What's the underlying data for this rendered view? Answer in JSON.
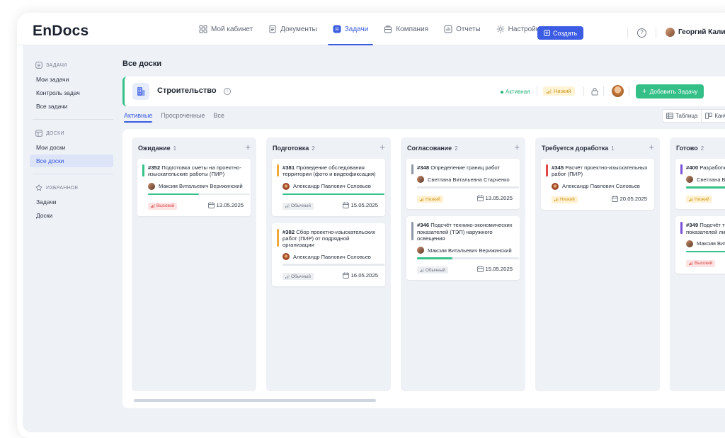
{
  "app": {
    "logo": "EnDocs"
  },
  "nav": [
    {
      "label": "Мой кабинет",
      "icon": "grid-icon",
      "active": false
    },
    {
      "label": "Документы",
      "icon": "document-icon",
      "active": false
    },
    {
      "label": "Задачи",
      "icon": "tasks-icon",
      "active": true
    },
    {
      "label": "Компания",
      "icon": "company-icon",
      "active": false
    },
    {
      "label": "Отчеты",
      "icon": "reports-icon",
      "active": false
    },
    {
      "label": "Настройки",
      "icon": "gear-icon",
      "active": false
    }
  ],
  "header": {
    "create_label": "Создать",
    "help_symbol": "?",
    "user_name": "Георгий Калинин"
  },
  "sidebar": {
    "sections": [
      {
        "title": "ЗАДАЧИ",
        "items": [
          "Мои задачи",
          "Контроль задач",
          "Все задачи"
        ]
      },
      {
        "title": "ДОСКИ",
        "items": [
          "Мои доски",
          "Все доски"
        ]
      },
      {
        "title": "ИЗБРАННОЕ",
        "items": [
          "Задачи",
          "Доски"
        ]
      }
    ],
    "active_item": "Все доски"
  },
  "page": {
    "title": "Все доски"
  },
  "board_header": {
    "title": "Строительство",
    "status": "Активная",
    "priority": "Низкий",
    "add_task_label": "Добавить Задачу"
  },
  "tabs": [
    "Активные",
    "Просроченные",
    "Все"
  ],
  "view_switch": {
    "table_label": "Таблица",
    "kanban_label": "Канбан"
  },
  "colors": {
    "accent": "#3b5ce0",
    "green": "#35c189",
    "high": "#d64545",
    "low": "#c99414"
  },
  "columns": [
    {
      "title": "Ожидание",
      "count": "1",
      "cards": [
        {
          "id": "#352",
          "title": "Подготовка сметы на проектно-изыскательские работы (ПИР)",
          "assignee": "Максим Витальевич Верижинский",
          "progress": 0.5,
          "priority": "Высокий",
          "priority_level": "high",
          "due": "13.05.2025",
          "bar_color": "#35c189"
        }
      ]
    },
    {
      "title": "Подготовка",
      "count": "2",
      "cards": [
        {
          "id": "#381",
          "title": "Проведение обследования территории (фото и видеофиксация)",
          "assignee": "Александр Павлович Соловьев",
          "progress": 1.0,
          "priority": "Обычный",
          "priority_level": "normal",
          "due": "15.05.2025",
          "bar_color": "#f2a93b"
        },
        {
          "id": "#382",
          "title": "Сбор проектно-изыскательских работ (ПИР) от подрядной организации",
          "assignee": "Александр Павлович Соловьев",
          "progress": 0,
          "priority": "Обычный",
          "priority_level": "normal",
          "due": "16.05.2025",
          "bar_color": "#f2a93b"
        }
      ]
    },
    {
      "title": "Согласование",
      "count": "2",
      "cards": [
        {
          "id": "#348",
          "title": "Определение границ работ",
          "assignee": "Светлана Витальевна Старченко",
          "progress": 0,
          "priority": "Низкий",
          "priority_level": "low",
          "due": "13.05.2025",
          "bar_color": "#8e97a8"
        },
        {
          "id": "#346",
          "title": "Подсчёт технико-экономических показателей (ТЭП) наружного освещения",
          "assignee": "Максим Витальевич Верижинский",
          "progress": 0.35,
          "priority": "Обычный",
          "priority_level": "normal",
          "due": "15.05.2025",
          "bar_color": "#8e97a8"
        }
      ]
    },
    {
      "title": "Требуется доработка",
      "count": "1",
      "cards": [
        {
          "id": "#345",
          "title": "Расчёт проектно-изыскательных работ (ПИР)",
          "assignee": "Александр Павлович Соловьев",
          "progress": null,
          "priority": "Низкий",
          "priority_level": "low",
          "due": "20.05.2025",
          "bar_color": "#e24848"
        }
      ]
    },
    {
      "title": "Готово",
      "count": "2",
      "cards": [
        {
          "id": "#400",
          "title": "Разработка плана",
          "assignee": "Светлана Витальевна",
          "progress": 1.0,
          "priority": "Низкий",
          "priority_level": "low",
          "due": "",
          "bar_color": "#7b52d6"
        },
        {
          "id": "#349",
          "title": "Подсчёт технико-экономических показателей линейного объекта",
          "assignee": "Максим Витальевич",
          "progress": 1.0,
          "priority": "Высокий",
          "priority_level": "high",
          "due": "",
          "bar_color": "#7b52d6"
        }
      ]
    }
  ]
}
